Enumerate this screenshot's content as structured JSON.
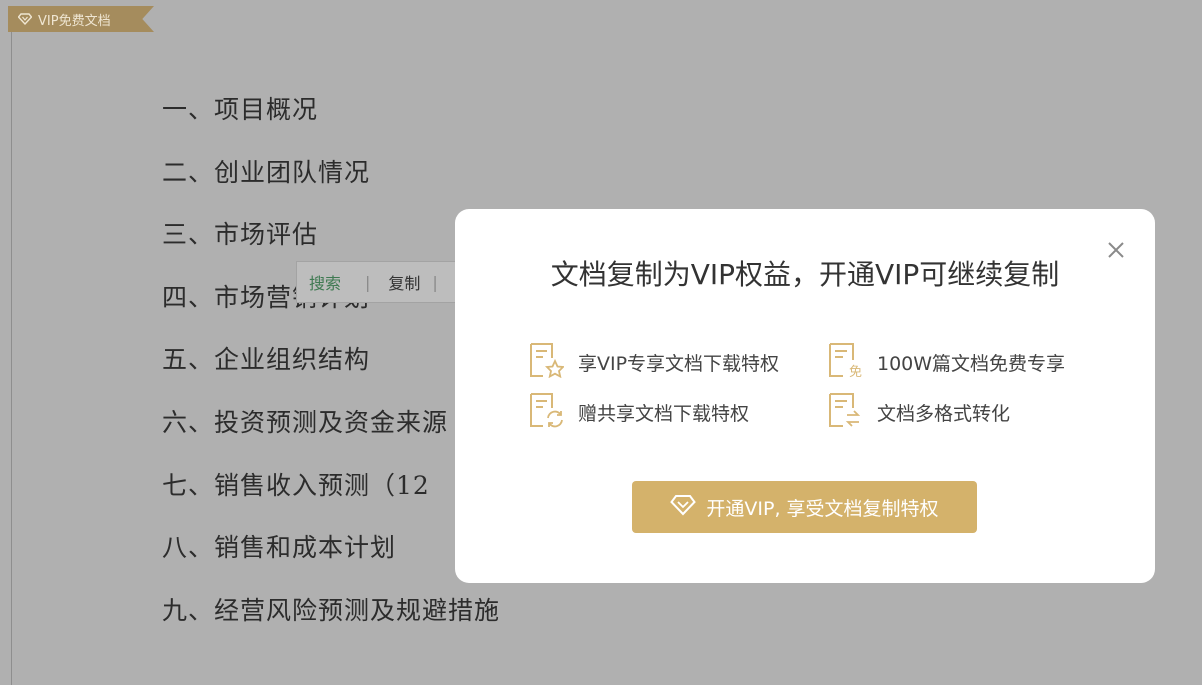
{
  "ribbon": {
    "label": "VIP免费文档",
    "icon": "diamond-icon"
  },
  "document": {
    "lines": [
      "一、项目概况",
      "二、创业团队情况",
      "三、市场评估",
      "四、市场营销计划",
      "五、企业组织结构",
      "六、投资预测及资金来源",
      "七、销售收入预测（12",
      "八、销售和成本计划",
      "九、经营风险预测及规避措施"
    ]
  },
  "context_toolbar": {
    "search_label": "搜索",
    "separator": "|",
    "copy_label": "复制"
  },
  "modal": {
    "title": "文档复制为VIP权益，开通VIP可继续复制",
    "close_icon": "close-icon",
    "benefits": [
      {
        "text": "享VIP专享文档下载特权",
        "icon": "document-star-icon"
      },
      {
        "text": "100W篇文档免费专享",
        "icon": "document-free-icon",
        "icon_badge": "免"
      },
      {
        "text": "赠共享文档下载特权",
        "icon": "document-refresh-icon"
      },
      {
        "text": "文档多格式转化",
        "icon": "document-convert-icon"
      }
    ],
    "cta_label": "开通VIP, 享受文档复制特权",
    "cta_icon": "diamond-icon"
  },
  "colors": {
    "overlay": "#b0b0b0",
    "gold": "#d4b26b",
    "ribbon": "#a58c5d",
    "icon_gold": "#d9b877"
  }
}
